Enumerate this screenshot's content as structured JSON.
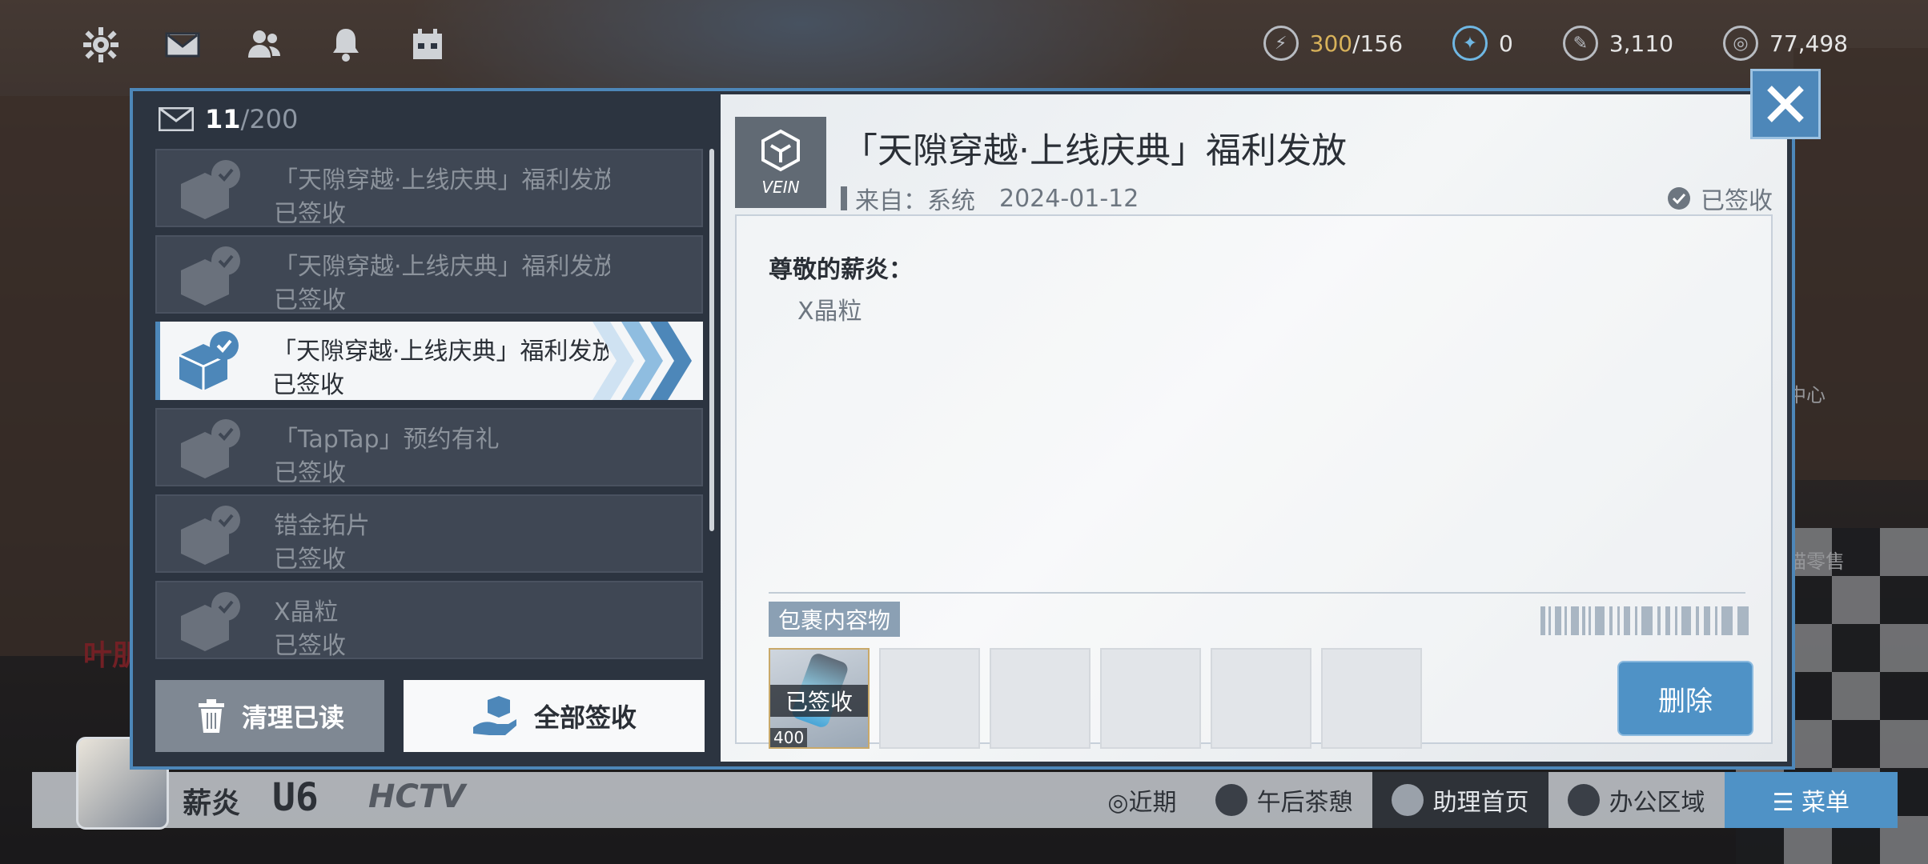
{
  "top_icons": [
    "gear-icon",
    "mail-icon",
    "friends-icon",
    "bell-icon",
    "calendar-icon"
  ],
  "resources": [
    {
      "icon": "stamina-icon",
      "value": "300",
      "max": "/156"
    },
    {
      "icon": "crystal-icon",
      "value": "0"
    },
    {
      "icon": "pen-icon",
      "value": "3,110"
    },
    {
      "icon": "coin-icon",
      "value": "77,498"
    }
  ],
  "mail": {
    "count": "11",
    "max": "/200",
    "items": [
      {
        "title": "「天隙穿越·上线庆典」福利发放",
        "status": "已签收"
      },
      {
        "title": "「天隙穿越·上线庆典」福利发放",
        "status": "已签收"
      },
      {
        "title": "「天隙穿越·上线庆典」福利发放",
        "status": "已签收"
      },
      {
        "title": "「TapTap」预约有礼",
        "status": "已签收"
      },
      {
        "title": "错金拓片",
        "status": "已签收"
      },
      {
        "title": "X晶粒",
        "status": "已签收"
      }
    ],
    "clear_label": "清理已读",
    "claim_all_label": "全部签收"
  },
  "detail": {
    "logo_text": "VEIN",
    "title": "「天隙穿越·上线庆典」福利发放",
    "from_label": "来自：",
    "from": "系统",
    "date": "2024-01-12",
    "status": "已签收",
    "greeting": "尊敬的薪炎：",
    "body": "X晶粒",
    "package_label": "包裹内容物",
    "attachment_overlay": "已签收",
    "attachment_qty": "400",
    "delete_label": "删除"
  },
  "side": {
    "right_text_1": "中心",
    "right_text_2": "喵零售",
    "left_text": "叶朋"
  },
  "bottom_bar": {
    "name": "薪炎",
    "level": "U6",
    "hctv": "HCTV",
    "nav": [
      {
        "label": "◎近期"
      },
      {
        "label": "午后茶憩"
      },
      {
        "label": "助理首页"
      },
      {
        "label": "办公区域"
      },
      {
        "label": "☰  菜单"
      }
    ]
  }
}
